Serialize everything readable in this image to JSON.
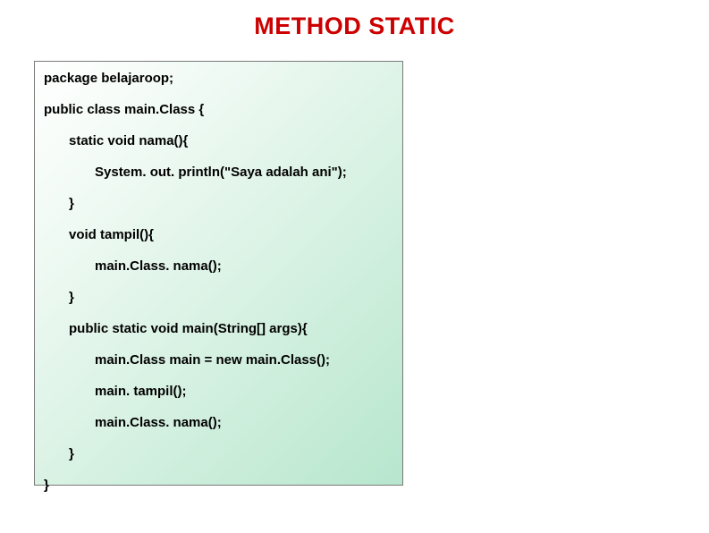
{
  "title": "METHOD STATIC",
  "code": {
    "line1": "package belajaroop;",
    "line2": "public class main.Class {",
    "line3": "static void nama(){",
    "line4": "System. out. println(\"Saya adalah ani\");",
    "line5": "}",
    "line6": "void tampil(){",
    "line7": "main.Class. nama();",
    "line8": "}",
    "line9": "public static void main(String[] args){",
    "line10": "main.Class main = new main.Class();",
    "line11": "main. tampil();",
    "line12": "main.Class. nama();",
    "line13": "}",
    "line14": "}"
  }
}
